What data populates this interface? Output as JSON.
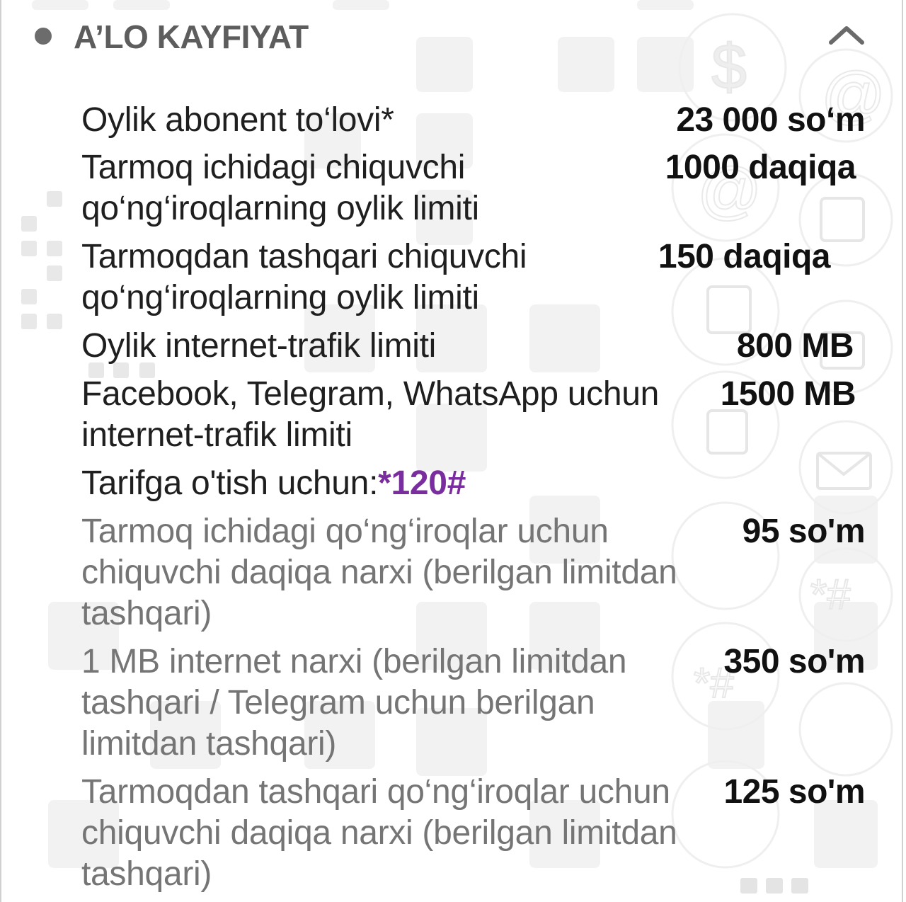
{
  "tariff": {
    "title": "A’LO KAYFIYAT",
    "collapse_icon": "chevron-up-icon",
    "bullet_icon": "dot-icon"
  },
  "rows": [
    {
      "label_lines": [
        "Oylik abonent to‘lovi*"
      ],
      "value": "23 000 so‘m"
    },
    {
      "label_lines": [
        "Tarmoq ichidagi chiquvchi",
        "qo‘ng‘iroqlarning oylik limiti"
      ],
      "value": "1000 daqiqa"
    },
    {
      "label_lines": [
        "Tarmoqdan tashqari chiquvchi",
        "qo‘ng‘iroqlarning oylik limiti"
      ],
      "value": "150 daqiqa"
    },
    {
      "label_lines": [
        "Oylik internet-trafik limiti"
      ],
      "value": "800 MB"
    },
    {
      "label_lines": [
        "Facebook, Telegram, WhatsApp uchun",
        "internet-trafik limiti"
      ],
      "value": "1500 MB"
    }
  ],
  "switch": {
    "label": "Tarifga o'tish uchun:",
    "code": "*120#"
  },
  "extra_rows": [
    {
      "label_lines": [
        "Tarmoq ichidagi qo‘ng‘iroqlar uchun",
        "chiquvchi daqiqa narxi (berilgan limitdan",
        "tashqari)"
      ],
      "value": "95 so'm"
    },
    {
      "label_lines": [
        "1 MB internet narxi (berilgan limitdan",
        "tashqari / Telegram uchun berilgan",
        "limitdan tashqari)"
      ],
      "value": "350 so'm"
    },
    {
      "label_lines": [
        "Tarmoqdan tashqari qo‘ng‘iroqlar uchun",
        "chiquvchi daqiqa narxi (berilgan limitdan",
        "tashqari)"
      ],
      "value": "125 so'm"
    }
  ],
  "colors": {
    "accent": "#7a2d9e",
    "title": "#5d5d5d",
    "primary_text": "#1f1f1f",
    "secondary_text": "#757575"
  }
}
